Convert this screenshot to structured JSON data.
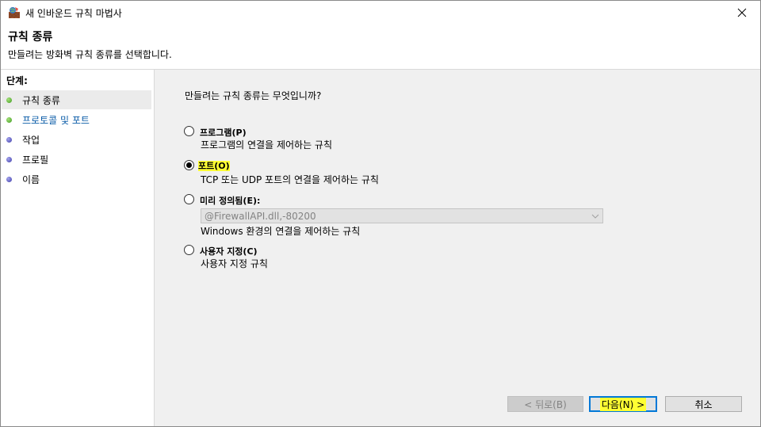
{
  "window": {
    "title": "새 인바운드 규칙 마법사",
    "close_icon": "close-icon"
  },
  "header": {
    "title": "규칙 종류",
    "description": "만들려는 방화벽 규칙 종류를 선택합니다."
  },
  "steps": {
    "label": "단계:",
    "items": [
      {
        "label": "규칙 종류",
        "status": "green",
        "current": true
      },
      {
        "label": "프로토콜 및 포트",
        "status": "green",
        "link": true
      },
      {
        "label": "작업",
        "status": "blue"
      },
      {
        "label": "프로필",
        "status": "blue"
      },
      {
        "label": "이름",
        "status": "blue"
      }
    ]
  },
  "content": {
    "question": "만들려는 규칙 종류는 무엇입니까?",
    "options": [
      {
        "label": "프로그램(P)",
        "description": "프로그램의 연결을 제어하는 규칙",
        "checked": false
      },
      {
        "label": "포트(O)",
        "description": "TCP 또는 UDP 포트의 연결을 제어하는 규칙",
        "checked": true
      },
      {
        "label": "미리 정의됨(E):",
        "description": "Windows 환경의 연결을 제어하는 규칙",
        "checked": false
      },
      {
        "label": "사용자 지정(C)",
        "description": "사용자 지정 규칙",
        "checked": false
      }
    ],
    "predefined_select": {
      "value": "@FirewallAPI.dll,-80200",
      "disabled": true
    }
  },
  "buttons": {
    "back": "< 뒤로(B)",
    "next": "다음(N) >",
    "cancel": "취소"
  },
  "colors": {
    "highlight": "#ffff33",
    "link": "#0b5ca8",
    "accent": "#0078d7"
  }
}
